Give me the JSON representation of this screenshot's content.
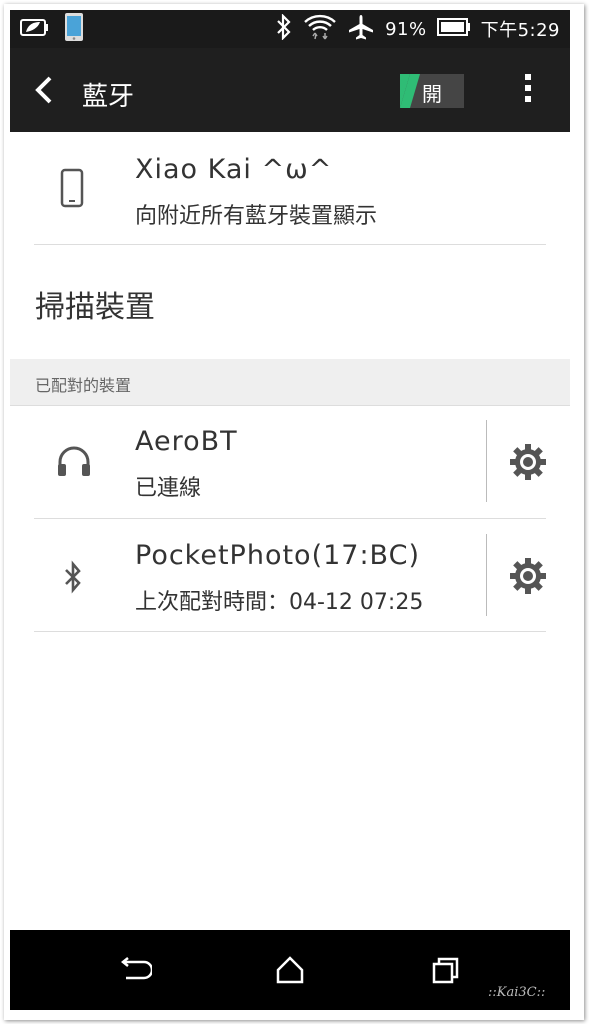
{
  "status_bar": {
    "battery_percent": "91%",
    "time": "下午5:29",
    "icons": [
      "eco-battery-icon",
      "phone-icon",
      "bluetooth-icon",
      "wifi-icon",
      "airplane-icon",
      "battery-icon"
    ]
  },
  "action_bar": {
    "title": "藍牙",
    "toggle_label": "開",
    "toggle_on": true,
    "accent_color": "#2fbc75"
  },
  "device": {
    "name": "Xiao Kai ^ω^",
    "visibility": "向附近所有藍牙裝置顯示"
  },
  "scan": {
    "label": "掃描裝置"
  },
  "paired_section": {
    "header": "已配對的裝置",
    "devices": [
      {
        "icon": "headphones-icon",
        "name": "AeroBT",
        "status": "已連線"
      },
      {
        "icon": "bluetooth-icon",
        "name": "PocketPhoto(17:BC)",
        "status": "上次配對時間：04-12 07:25"
      }
    ]
  },
  "nav_bar": {
    "buttons": [
      "back-icon",
      "home-icon",
      "recent-apps-icon"
    ]
  },
  "watermark": "::Kai3C::"
}
